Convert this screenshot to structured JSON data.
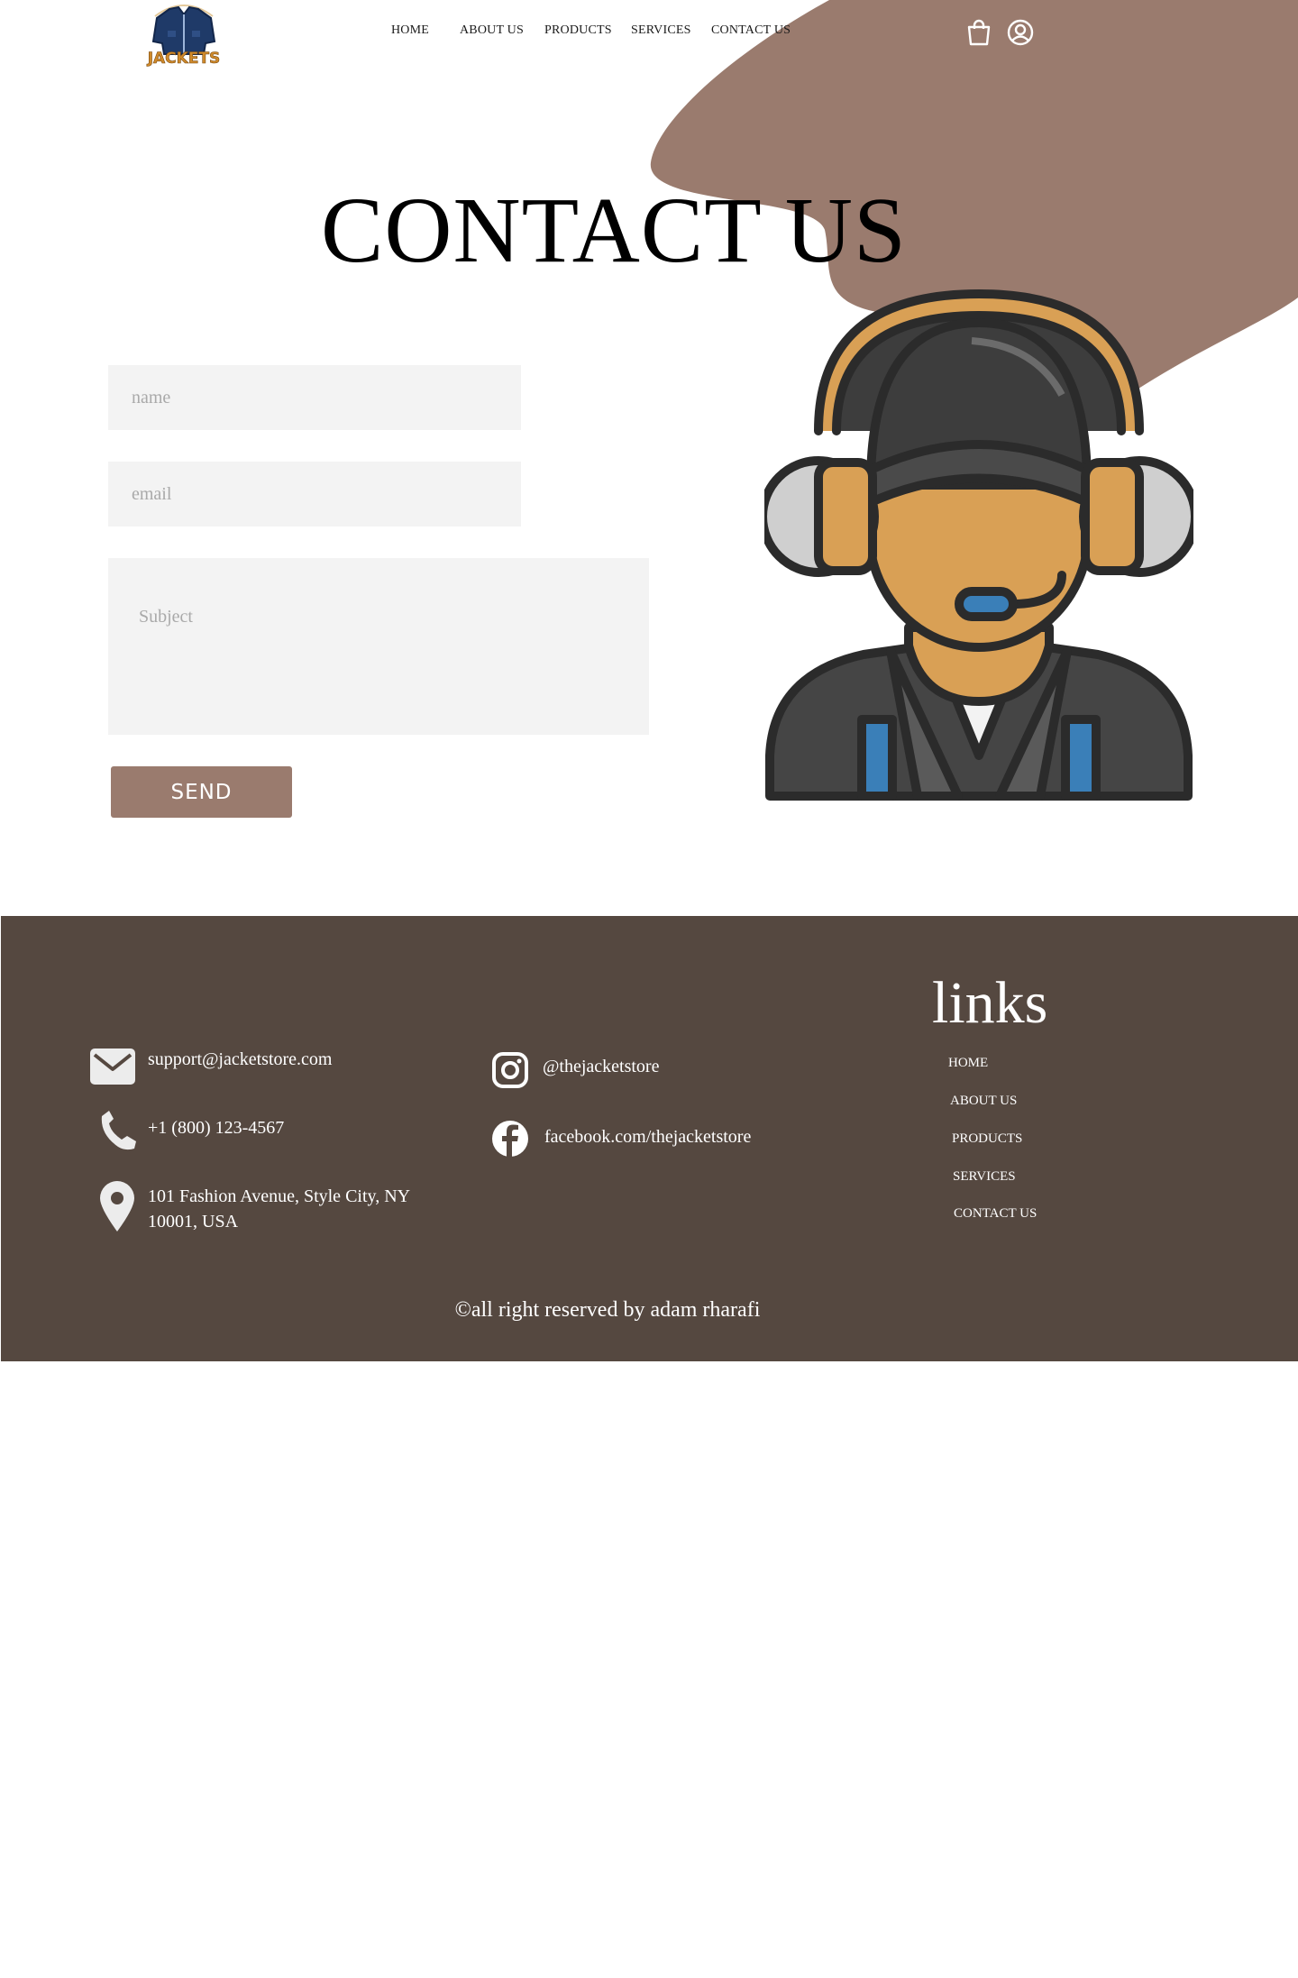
{
  "brand": {
    "logo_text": "JACKETS"
  },
  "nav": {
    "items": [
      {
        "label": "HOME"
      },
      {
        "label": "ABOUT US"
      },
      {
        "label": "PRODUCTS"
      },
      {
        "label": "SERVICES"
      },
      {
        "label": "CONTACT US"
      }
    ]
  },
  "header_icons": [
    "shopping-bag-icon",
    "user-account-icon"
  ],
  "hero": {
    "title": "CONTACT US"
  },
  "form": {
    "name_placeholder": "name",
    "email_placeholder": "email",
    "subject_placeholder": "Subject",
    "send_label": "SEND"
  },
  "illustration": {
    "icon": "support-agent-headset-illustration"
  },
  "colors": {
    "accent_blob": "#9a7b6e",
    "button": "#9a7b6e",
    "footer_bg": "#554840",
    "field_bg": "#f3f3f3"
  },
  "footer": {
    "contact": {
      "email": "support@jacketstore.com",
      "phone": "+1 (800) 123-4567",
      "address_line1": "101 Fashion Avenue, Style City, NY",
      "address_line2": "10001, USA"
    },
    "social": {
      "instagram": "@thejacketstore",
      "facebook": "facebook.com/thejacketstore"
    },
    "links_title": "links",
    "links": [
      {
        "label": "HOME"
      },
      {
        "label": "ABOUT US"
      },
      {
        "label": "PRODUCTS"
      },
      {
        "label": "SERVICES"
      },
      {
        "label": "CONTACT US"
      }
    ],
    "copyright": "©all right reserved by adam rharafi"
  }
}
